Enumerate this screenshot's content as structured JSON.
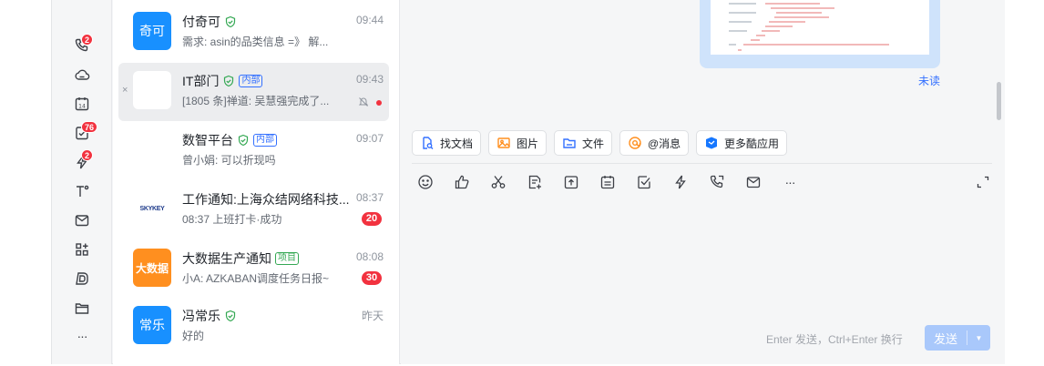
{
  "rail": {
    "items": [
      {
        "icon": "phone-icon",
        "badge": "2"
      },
      {
        "icon": "cloud-icon",
        "badge": ""
      },
      {
        "icon": "calendar-icon",
        "badge": ""
      },
      {
        "icon": "task-check-icon",
        "badge": "76"
      },
      {
        "icon": "lightning-icon",
        "badge": "2"
      },
      {
        "icon": "temperature-icon",
        "badge": ""
      },
      {
        "icon": "mail-icon",
        "badge": ""
      },
      {
        "icon": "apps-grid-icon",
        "badge": ""
      },
      {
        "icon": "document-d-icon",
        "badge": ""
      },
      {
        "icon": "folder-icon",
        "badge": ""
      },
      {
        "icon": "more-icon",
        "badge": ""
      }
    ],
    "more_label": "···"
  },
  "conversations": [
    {
      "name": "付奇可",
      "avatar_text": "奇可",
      "avatar_color": "#1890ff",
      "verified": true,
      "tag": "",
      "preview": "需求: asin的品类信息 =》 解...",
      "time": "09:44",
      "unread": "",
      "active": false
    },
    {
      "name": "IT部门",
      "avatar_text": "",
      "avatar_color": "#ffffff",
      "verified": true,
      "tag": "内部",
      "preview": "[1805 条]禅道: 吴慧强完成了...",
      "time": "09:43",
      "unread": "",
      "active": true,
      "muted": true
    },
    {
      "name": "数智平台",
      "avatar_text": "",
      "avatar_color": "#ffffff",
      "verified": true,
      "tag": "内部",
      "preview": "曾小娟: 可以折现吗",
      "time": "09:07",
      "unread": "",
      "active": false
    },
    {
      "name": "工作通知:上海众结网络科技...",
      "avatar_text": "SKYKEY",
      "avatar_color": "#ffffff",
      "verified": false,
      "tag": "",
      "preview": "08:37 上班打卡·成功",
      "time": "08:37",
      "unread": "20",
      "active": false
    },
    {
      "name": "大数据生产通知",
      "avatar_text": "大数据",
      "avatar_color": "#ff8f1f",
      "verified": false,
      "tag": "项目",
      "preview": "小A: AZKABAN调度任务日报~",
      "time": "08:08",
      "unread": "30",
      "active": false
    },
    {
      "name": "冯常乐",
      "avatar_text": "常乐",
      "avatar_color": "#1890ff",
      "verified": true,
      "tag": "",
      "preview": "好的",
      "time": "昨天",
      "unread": "",
      "active": false
    }
  ],
  "chat": {
    "unread_label": "未读",
    "quick_actions": [
      {
        "label": "找文档",
        "icon": "find-doc-icon"
      },
      {
        "label": "图片",
        "icon": "image-icon"
      },
      {
        "label": "文件",
        "icon": "folder-file-icon"
      },
      {
        "label": "@消息",
        "icon": "at-icon"
      },
      {
        "label": "更多酷应用",
        "icon": "cool-apps-icon"
      }
    ],
    "toolbar": [
      "emoji-icon",
      "thumbs-up-icon",
      "scissors-icon",
      "doc-add-icon",
      "upload-icon",
      "calendar-list-icon",
      "checkbox-icon",
      "lightning-icon",
      "call-icon",
      "mail-icon",
      "more-icon",
      "expand-icon"
    ],
    "toolbar_more_label": "···",
    "hint": "Enter 发送，Ctrl+Enter 换行",
    "send_label": "发送",
    "send_arrow": "▼"
  },
  "colors": {
    "accent": "#3370ff",
    "badge_red": "#f2323f",
    "send_disabled": "#a9c8fb"
  }
}
